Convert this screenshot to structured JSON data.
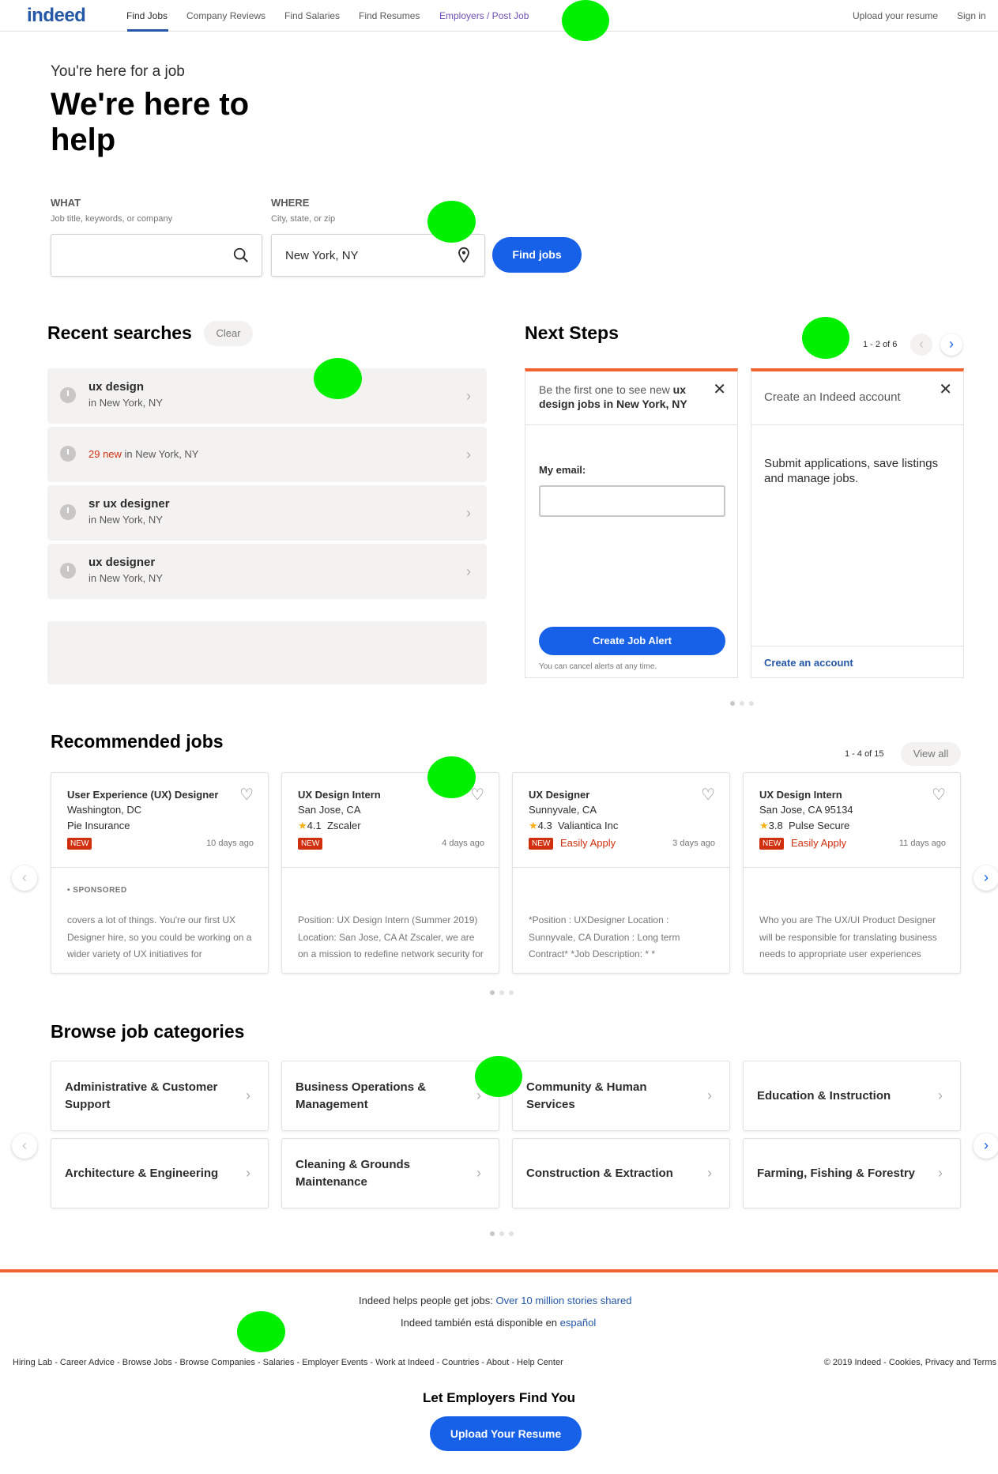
{
  "nav": {
    "logo": "indeed",
    "links": [
      "Find Jobs",
      "Company Reviews",
      "Find Salaries",
      "Find Resumes",
      "Employers / Post Job"
    ],
    "right": [
      "Upload your resume",
      "Sign in"
    ]
  },
  "hero": {
    "subtitle": "You're here for a job",
    "title": "We're here to help"
  },
  "search": {
    "what_label": "WHAT",
    "what_hint": "Job title, keywords, or company",
    "what_value": "",
    "where_label": "WHERE",
    "where_hint": "City, state, or zip",
    "where_value": "New York, NY",
    "button": "Find jobs"
  },
  "recent": {
    "title": "Recent searches",
    "clear": "Clear",
    "items": [
      {
        "query": "ux design",
        "location": "in New York, NY"
      },
      {
        "new_count": "29 new",
        "location": "in New York, NY"
      },
      {
        "query": "sr ux designer",
        "location": "in New York, NY"
      },
      {
        "query": "ux designer",
        "location": "in New York, NY"
      }
    ]
  },
  "next_steps": {
    "title": "Next Steps",
    "pagination": "1 - 2 of 6",
    "alert_card": {
      "head_pre": "Be the first one to see new",
      "head_bold": "ux design jobs in New York, NY",
      "email_label": "My email:",
      "email_value": "",
      "button": "Create Job Alert",
      "note": "You can cancel alerts at any time."
    },
    "account_card": {
      "head": "Create an Indeed account",
      "body": "Submit applications, save listings and manage jobs.",
      "link": "Create an account"
    }
  },
  "recommended": {
    "title": "Recommended jobs",
    "pagination": "1 - 4 of 15",
    "view_all": "View all",
    "jobs": [
      {
        "title": "User Experience (UX) Designer",
        "location": "Washington, DC",
        "company": "Pie Insurance",
        "rating": "",
        "badge": "NEW",
        "easy": "",
        "ago": "10 days ago",
        "sponsored": "• SPONSORED",
        "snippet": "covers a lot of things. You're our first UX Designer hire, so you could be working on a wider variety of UX initiatives for"
      },
      {
        "title": "UX Design Intern",
        "location": "San Jose, CA",
        "company": "Zscaler",
        "rating": "4.1",
        "badge": "NEW",
        "easy": "",
        "ago": "4 days ago",
        "sponsored": "",
        "snippet": "Position: UX Design Intern (Summer 2019) Location: San Jose, CA At Zscaler, we are on a mission to redefine network security for the Cloud"
      },
      {
        "title": "UX Designer",
        "location": "Sunnyvale, CA",
        "company": "Valiantica Inc",
        "rating": "4.3",
        "badge": "NEW",
        "easy": "Easily Apply",
        "ago": "3 days ago",
        "sponsored": "",
        "snippet": "*Position : UXDesigner Location : Sunnyvale, CA Duration : Long term Contract* *Job Description: * * *UXdesigningexperience* * *Experience"
      },
      {
        "title": "UX Design Intern",
        "location": "San Jose, CA 95134",
        "company": "Pulse Secure",
        "rating": "3.8",
        "badge": "NEW",
        "easy": "Easily Apply",
        "ago": "11 days ago",
        "sponsored": "",
        "snippet": "Who you are The UX/UI Product Designer will be responsible for translating business needs to appropriate user experiences (including"
      }
    ]
  },
  "categories": {
    "title": "Browse job categories",
    "items": [
      "Administrative & Customer Support",
      "Business Operations & Management",
      "Community & Human Services",
      "Education & Instruction",
      "Architecture & Engineering",
      "Cleaning & Grounds Maintenance",
      "Construction & Extraction",
      "Farming, Fishing & Forestry"
    ]
  },
  "footer": {
    "stories_pre": "Indeed helps people get jobs:",
    "stories_link": "Over 10 million stories shared",
    "spanish_pre": "Indeed también está disponible en",
    "spanish_link": "español",
    "links_left": "Hiring Lab - Career Advice - Browse Jobs - Browse Companies - Salaries - Employer Events - Work at Indeed - Countries - About - Help Center",
    "links_right": "© 2019 Indeed - Cookies, Privacy and Terms",
    "cta_title": "Let Employers Find You",
    "cta_button": "Upload Your Resume"
  },
  "colors": {
    "brand": "#2557a7",
    "button": "#1760e8",
    "accent": "#f2622e",
    "new_badge": "#d1300f",
    "marker": "#00f000"
  }
}
